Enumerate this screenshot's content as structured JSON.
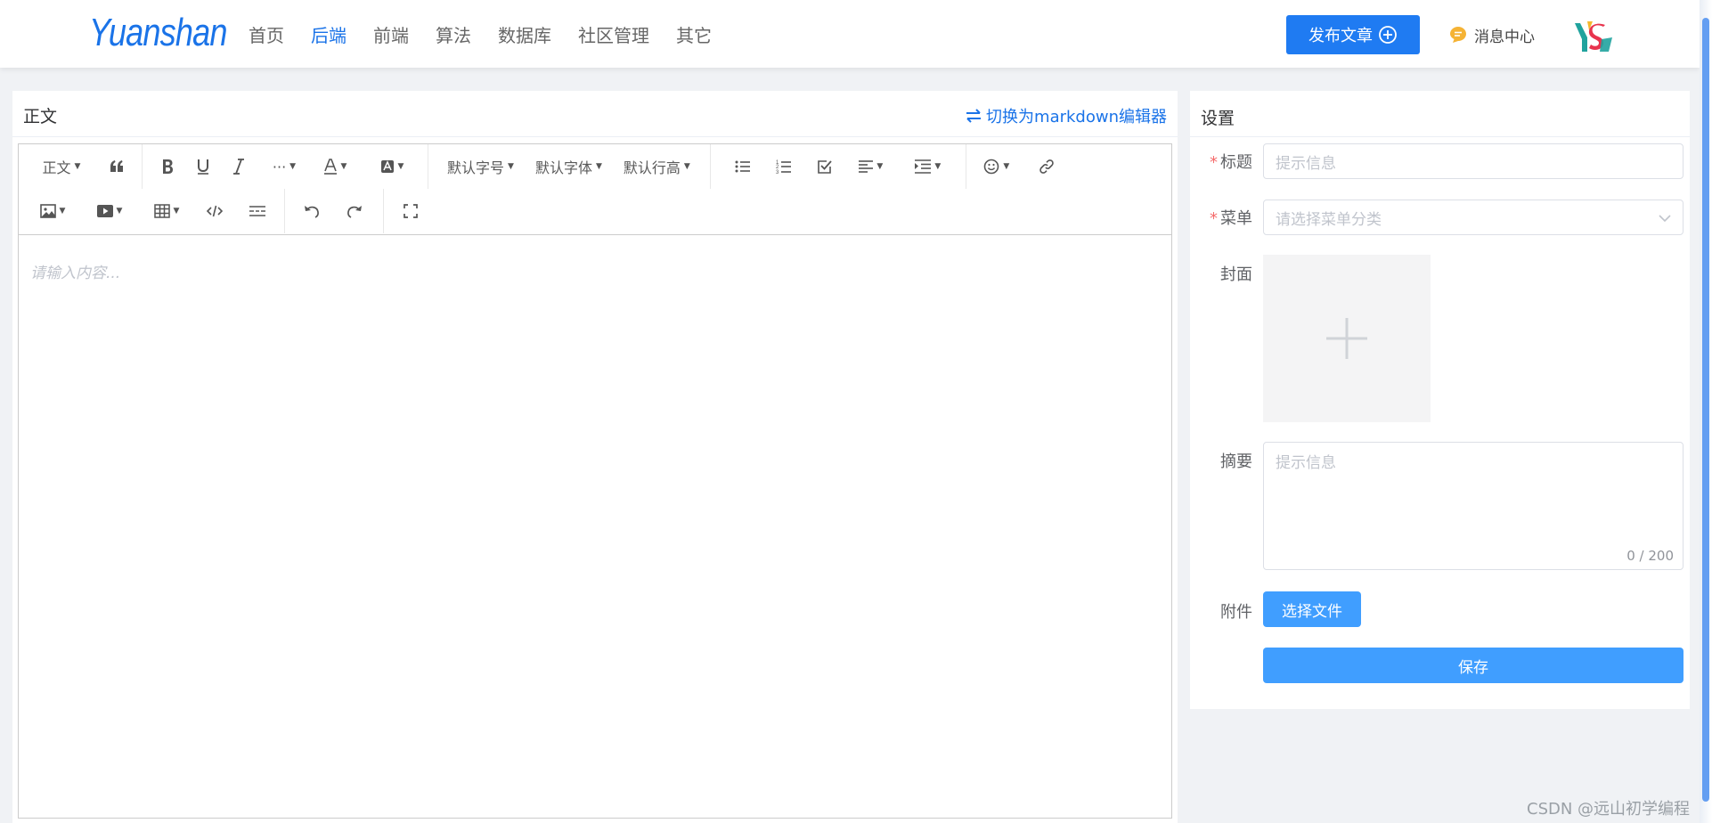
{
  "header": {
    "logo": "Yuanshan",
    "nav": [
      {
        "label": "首页",
        "active": false
      },
      {
        "label": "后端",
        "active": true
      },
      {
        "label": "前端",
        "active": false
      },
      {
        "label": "算法",
        "active": false
      },
      {
        "label": "数据库",
        "active": false
      },
      {
        "label": "社区管理",
        "active": false
      },
      {
        "label": "其它",
        "active": false
      }
    ],
    "publish_label": "发布文章",
    "message_center": "消息中心"
  },
  "editor": {
    "title": "正文",
    "switch_label": "切换为markdown编辑器",
    "placeholder": "请输入内容...",
    "toolbar": {
      "heading": "正文",
      "font_size": "默认字号",
      "font_family": "默认字体",
      "line_height": "默认行高"
    }
  },
  "settings": {
    "title": "设置",
    "title_label": "标题",
    "title_placeholder": "提示信息",
    "menu_label": "菜单",
    "menu_placeholder": "请选择菜单分类",
    "cover_label": "封面",
    "summary_label": "摘要",
    "summary_placeholder": "提示信息",
    "summary_counter": "0 / 200",
    "attachment_label": "附件",
    "select_file": "选择文件",
    "save": "保存"
  },
  "colors": {
    "accent": "#1a73e8",
    "primary_button": "#409eff",
    "required": "#f56c6c"
  },
  "watermark": "CSDN @远山初学编程"
}
